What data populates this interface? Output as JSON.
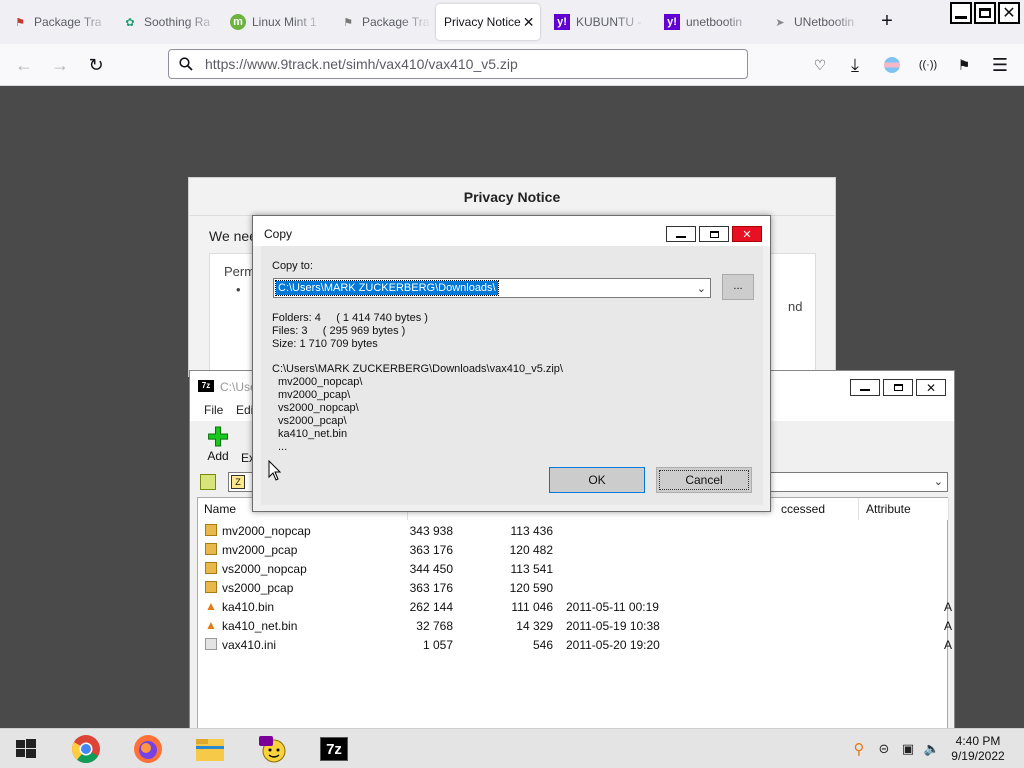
{
  "browser": {
    "tabs": [
      {
        "label": "Package Tra",
        "icon": "package-icon",
        "color": "#b44"
      },
      {
        "label": "Soothing Ra",
        "icon": "leaf-icon",
        "color": "#2a8"
      },
      {
        "label": "Linux Mint 1",
        "icon": "mint-icon",
        "color": "#6b3"
      },
      {
        "label": "Package Tra",
        "icon": "package-icon",
        "color": "#b44"
      },
      {
        "label": "Privacy Notice",
        "icon": "",
        "color": ""
      },
      {
        "label": "KUBUNTU -",
        "icon": "yahoo-icon",
        "color": "#6001d2"
      },
      {
        "label": "unetbootin",
        "icon": "yahoo-icon",
        "color": "#6001d2"
      },
      {
        "label": "UNetbootin",
        "icon": "rocket-icon",
        "color": "#888"
      }
    ],
    "url": "https://www.9track.net/simh/vax410/vax410_v5.zip"
  },
  "privacy": {
    "title": "Privacy Notice",
    "intro": "We nee",
    "perm_label": "Perm",
    "bullet": "•",
    "right_fragment": "nd"
  },
  "sevenzip": {
    "title_fragment": "C:\\Use",
    "menu": {
      "file": "File",
      "edit": "Edi"
    },
    "toolbar": {
      "add": "Add",
      "extract": "Ex"
    },
    "columns": {
      "name": "Name",
      "accessed": "ccessed",
      "attributes": "Attribute"
    },
    "files": [
      {
        "name": "mv2000_nopcap",
        "size": "343 938",
        "packed": "113 436",
        "modified": "",
        "attr": "",
        "type": "folder"
      },
      {
        "name": "mv2000_pcap",
        "size": "363 176",
        "packed": "120 482",
        "modified": "",
        "attr": "",
        "type": "folder"
      },
      {
        "name": "vs2000_nopcap",
        "size": "344 450",
        "packed": "113 541",
        "modified": "",
        "attr": "",
        "type": "folder"
      },
      {
        "name": "vs2000_pcap",
        "size": "363 176",
        "packed": "120 590",
        "modified": "",
        "attr": "",
        "type": "folder"
      },
      {
        "name": "ka410.bin",
        "size": "262 144",
        "packed": "111 046",
        "modified": "2011-05-11 00:19",
        "attr": "A",
        "type": "cone"
      },
      {
        "name": "ka410_net.bin",
        "size": "32 768",
        "packed": "14 329",
        "modified": "2011-05-19 10:38",
        "attr": "A",
        "type": "cone"
      },
      {
        "name": "vax410.ini",
        "size": "1 057",
        "packed": "546",
        "modified": "2011-05-20 19:20",
        "attr": "A",
        "type": "ini"
      }
    ]
  },
  "copy_dialog": {
    "title": "Copy",
    "copy_to_label": "Copy to:",
    "path": "C:\\Users\\MARK ZUCKERBERG\\Downloads\\",
    "browse_label": "...",
    "folders": "Folders: 4     ( 1 414 740 bytes )",
    "files": "Files: 3     ( 295 969 bytes )",
    "size": "Size: 1 710 709 bytes",
    "archive_path": "C:\\Users\\MARK ZUCKERBERG\\Downloads\\vax410_v5.zip\\",
    "items": [
      "mv2000_nopcap\\",
      "mv2000_pcap\\",
      "vs2000_nopcap\\",
      "vs2000_pcap\\",
      "ka410_net.bin",
      "..."
    ],
    "ok": "OK",
    "cancel": "Cancel"
  },
  "taskbar": {
    "time": "4:40 PM",
    "date": "9/19/2022",
    "apps": [
      "windows-start-icon",
      "chrome-icon",
      "firefox-icon",
      "file-explorer-icon",
      "yahoo-messenger-icon",
      "7zip-icon"
    ]
  }
}
